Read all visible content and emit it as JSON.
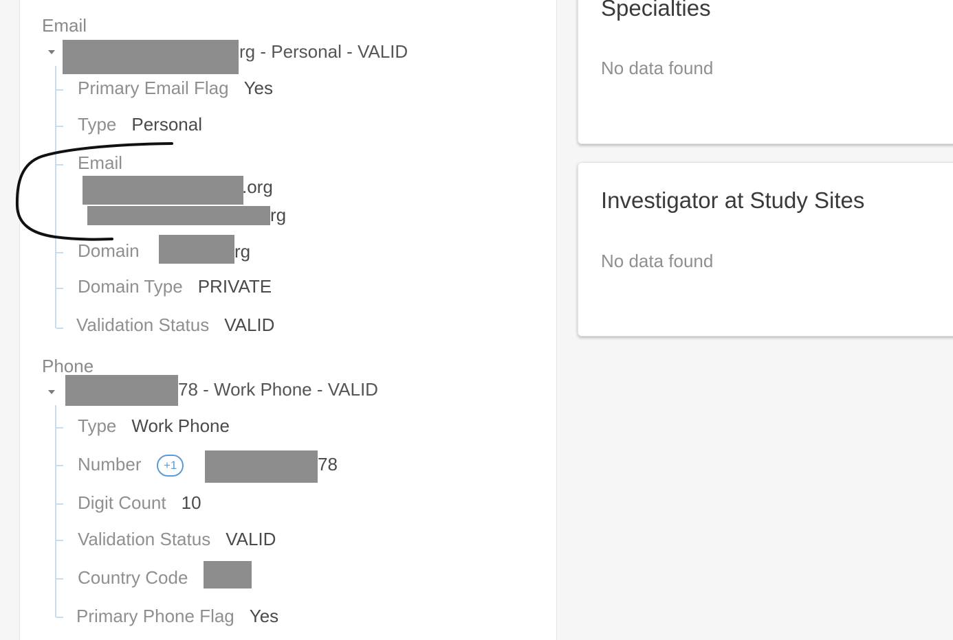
{
  "email_section": {
    "label": "Email",
    "header_suffix": "rg - Personal - VALID",
    "rows": {
      "primary_flag": {
        "label": "Primary Email Flag",
        "value": "Yes"
      },
      "type": {
        "label": "Type",
        "value": "Personal"
      },
      "email": {
        "label": "Email",
        "value_line1_suffix": ".org",
        "value_line2_suffix": "rg"
      },
      "domain": {
        "label": "Domain",
        "value_suffix": "rg"
      },
      "domain_type": {
        "label": "Domain Type",
        "value": "PRIVATE"
      },
      "validation_status": {
        "label": "Validation Status",
        "value": "VALID"
      }
    }
  },
  "phone_section": {
    "label": "Phone",
    "header_suffix": "78 - Work Phone - VALID",
    "rows": {
      "type": {
        "label": "Type",
        "value": "Work Phone"
      },
      "number": {
        "label": "Number",
        "country_code": "+1",
        "value_suffix": "78"
      },
      "digit_count": {
        "label": "Digit Count",
        "value": "10"
      },
      "validation_status": {
        "label": "Validation Status",
        "value": "VALID"
      },
      "country_code": {
        "label": "Country Code"
      },
      "primary_flag": {
        "label": "Primary Phone Flag",
        "value": "Yes"
      }
    }
  },
  "cards": {
    "specialties": {
      "title": "Specialties",
      "empty_text": "No data found"
    },
    "study_sites": {
      "title": "Investigator at Study Sites",
      "empty_text": "No data found"
    }
  },
  "colors": {
    "accent": "#5a9bd5",
    "tree_line": "#c9dcec",
    "redaction": "#8d8d8d"
  }
}
